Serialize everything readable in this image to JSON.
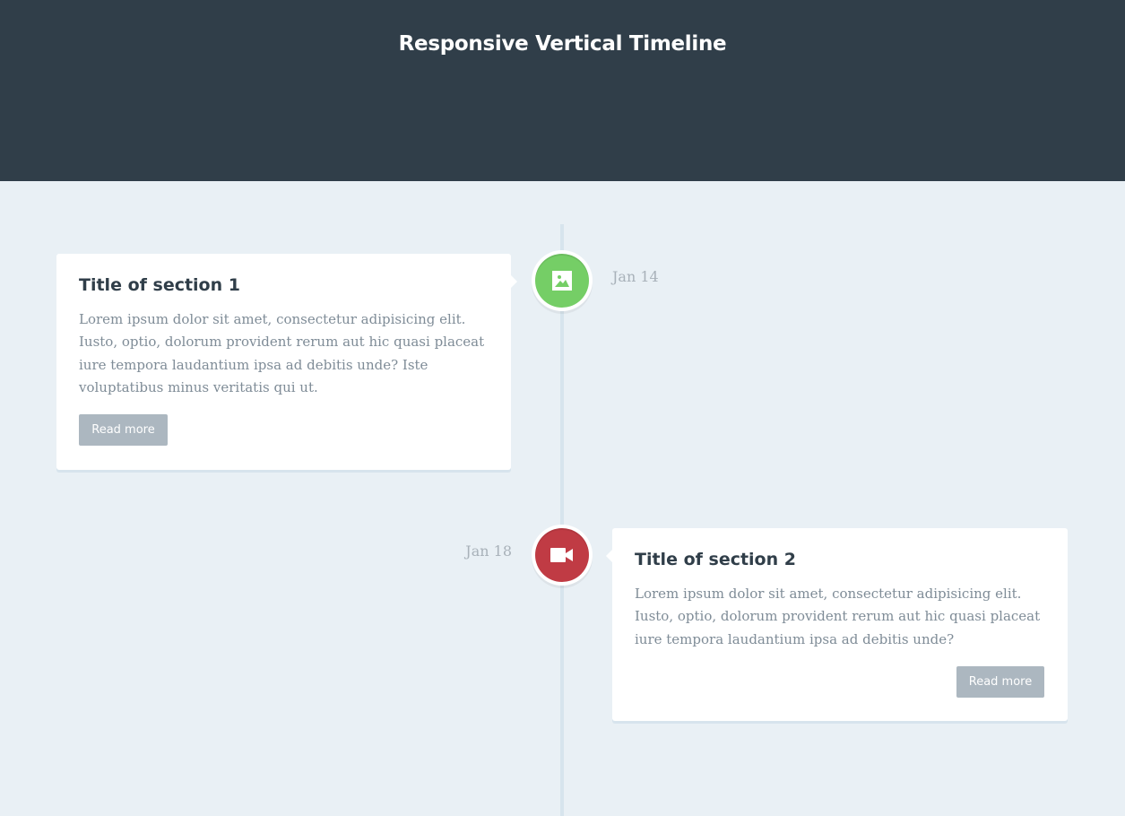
{
  "header": {
    "title": "Responsive Vertical Timeline"
  },
  "colors": {
    "header_bg": "#303e49",
    "page_bg": "#e9f0f5",
    "picture_dot": "#75ce66",
    "movie_dot": "#c03b44",
    "button_bg": "#acb7c0"
  },
  "timeline": {
    "items": [
      {
        "icon": "picture-icon",
        "title": "Title of section 1",
        "body": "Lorem ipsum dolor sit amet, consectetur adipisicing elit. Iusto, optio, dolorum provident rerum aut hic quasi placeat iure tempora laudantium ipsa ad debitis unde? Iste voluptatibus minus veritatis qui ut.",
        "button_label": "Read more",
        "date": "Jan 14"
      },
      {
        "icon": "movie-icon",
        "title": "Title of section 2",
        "body": "Lorem ipsum dolor sit amet, consectetur adipisicing elit. Iusto, optio, dolorum provident rerum aut hic quasi placeat iure tempora laudantium ipsa ad debitis unde?",
        "button_label": "Read more",
        "date": "Jan 18"
      }
    ]
  }
}
